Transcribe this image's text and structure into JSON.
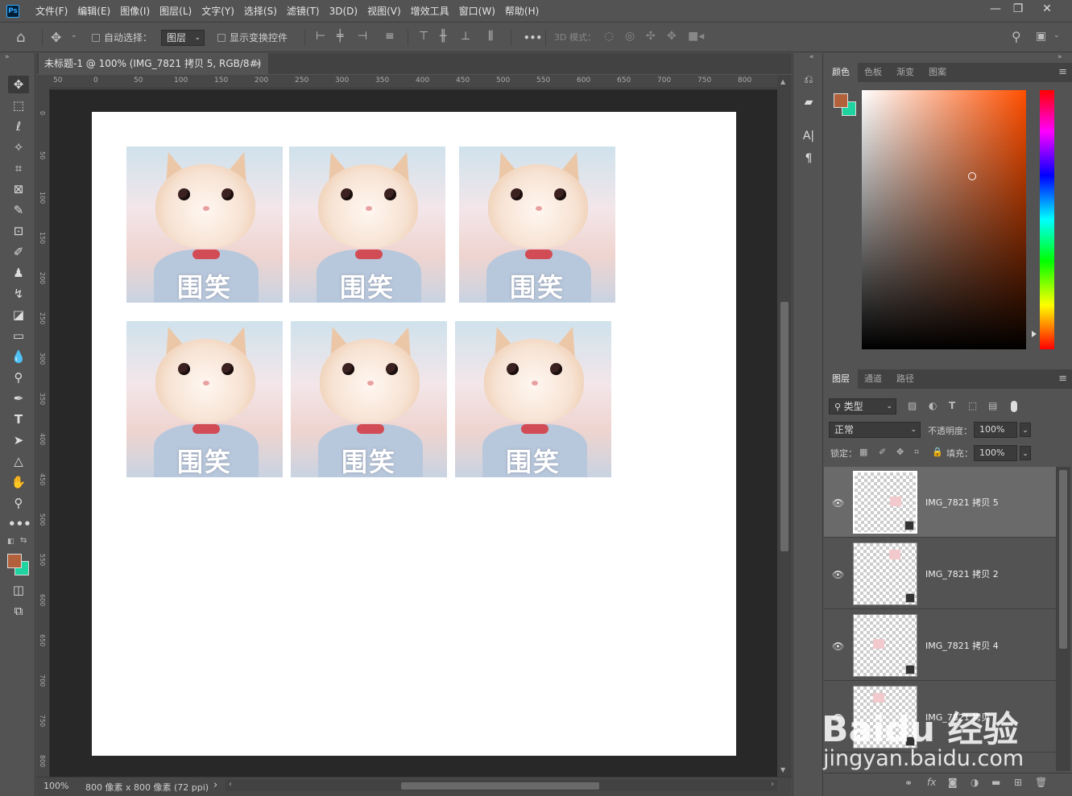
{
  "menubar": {
    "logo": "Ps",
    "items": [
      "文件(F)",
      "编辑(E)",
      "图像(I)",
      "图层(L)",
      "文字(Y)",
      "选择(S)",
      "滤镜(T)",
      "3D(D)",
      "视图(V)",
      "增效工具",
      "窗口(W)",
      "帮助(H)"
    ],
    "window_controls": [
      "minimize",
      "restore",
      "close"
    ]
  },
  "options_bar": {
    "auto_select_label": "自动选择：",
    "auto_select_checked": false,
    "target_select": "图层",
    "show_transform_label": "显示变换控件",
    "show_transform_checked": false,
    "more_label": "•••",
    "mode_3d_label": "3D 模式："
  },
  "document": {
    "tab_title": "未标题-1 @ 100% (IMG_7821 拷贝 5, RGB/8#) *",
    "tab_close": "×",
    "zoom": "100%",
    "doc_info": "800 像素 x 800 像素 (72 ppi)",
    "info_arrow": "›",
    "ruler_top": [
      "50",
      "0",
      "50",
      "100",
      "150",
      "200",
      "250",
      "300",
      "350",
      "400",
      "450",
      "500",
      "550",
      "600",
      "650",
      "700",
      "750",
      "800"
    ],
    "ruler_left": [
      "0",
      "50",
      "100",
      "150",
      "200",
      "250",
      "300",
      "350",
      "400",
      "450",
      "500",
      "550",
      "600",
      "650",
      "700",
      "750",
      "800"
    ],
    "image_caption": "围笑",
    "image_count": 6
  },
  "panels": {
    "color_tabs": [
      "颜色",
      "色板",
      "渐变",
      "图案"
    ],
    "fg_color": "#b3613b",
    "bg_color": "#1fd4a0",
    "layer_tabs": [
      "图层",
      "通道",
      "路径"
    ],
    "filter_label": "类型",
    "blend_mode": "正常",
    "opacity_label": "不透明度：",
    "opacity_value": "100%",
    "lock_label": "锁定：",
    "fill_label": "填充：",
    "fill_value": "100%",
    "layers": [
      {
        "name": "IMG_7821 拷贝 5",
        "selected": true,
        "visible": true
      },
      {
        "name": "IMG_7821 拷贝 2",
        "selected": false,
        "visible": true
      },
      {
        "name": "IMG_7821 拷贝 4",
        "selected": false,
        "visible": true
      },
      {
        "name": "IMG_7821 拷贝",
        "selected": false,
        "visible": true
      }
    ],
    "bottom_icons": [
      "link-icon",
      "fx-icon",
      "mask-icon",
      "adjustment-icon",
      "group-icon",
      "new-layer-icon",
      "trash-icon"
    ],
    "fx_label": "fx"
  },
  "watermark": {
    "line1": "Baidu 经验",
    "line2": "jingyan.baidu.com"
  }
}
